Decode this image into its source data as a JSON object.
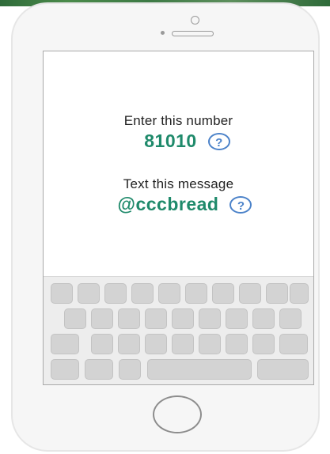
{
  "screen": {
    "number_prompt": "Enter this number",
    "number_value": "81010",
    "message_prompt": "Text this message",
    "message_value": "@cccbread",
    "help_symbol": "?"
  },
  "colors": {
    "accent_green": "#1f8a6b",
    "help_blue": "#4b82c9"
  },
  "icons": {
    "help": "question-circle-icon",
    "home": "home-button-icon"
  }
}
